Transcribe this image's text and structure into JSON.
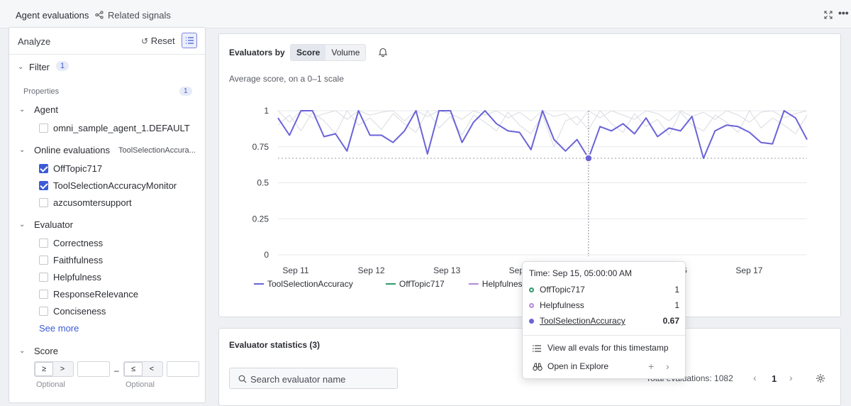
{
  "topbar": {
    "tab_agent_evaluations": "Agent evaluations",
    "tab_related_signals": "Related signals",
    "more_label": "•••"
  },
  "sidebar": {
    "title": "Analyze",
    "reset_label": "Reset",
    "filter_label": "Filter",
    "filter_count": "1",
    "properties_label": "Properties",
    "properties_count": "1",
    "agent": {
      "label": "Agent",
      "options": [
        {
          "label": "omni_sample_agent_1.DEFAULT",
          "checked": false
        }
      ]
    },
    "online_evaluations": {
      "label": "Online evaluations",
      "summary": "ToolSelectionAccura...",
      "options": [
        {
          "label": "OffTopic717",
          "checked": true
        },
        {
          "label": "ToolSelectionAccuracyMonitor",
          "checked": true
        },
        {
          "label": "azcusomtersupport",
          "checked": false
        }
      ]
    },
    "evaluator": {
      "label": "Evaluator",
      "options": [
        {
          "label": "Correctness",
          "checked": false
        },
        {
          "label": "Faithfulness",
          "checked": false
        },
        {
          "label": "Helpfulness",
          "checked": false
        },
        {
          "label": "ResponseRelevance",
          "checked": false
        },
        {
          "label": "Conciseness",
          "checked": false
        }
      ],
      "see_more": "See more"
    },
    "score": {
      "label": "Score",
      "min_ops": [
        "≥",
        ">"
      ],
      "max_ops": [
        "≤",
        "<"
      ],
      "separator": "–",
      "min_hint": "Optional",
      "max_hint": "Optional"
    }
  },
  "chart_panel": {
    "title": "Evaluators by",
    "toggle_score": "Score",
    "toggle_volume": "Volume",
    "subtitle": "Average score, on a 0–1 scale"
  },
  "chart_data": {
    "type": "line",
    "ylim": [
      0,
      1
    ],
    "y_ticks": [
      "0",
      "0.25",
      "0.5",
      "0.75",
      "1"
    ],
    "x_ticks": [
      "Sep 11",
      "Sep 12",
      "Sep 13",
      "Sep 14",
      "Sep 15",
      "Sep 16",
      "Sep 17"
    ],
    "x_range_days": [
      10.85,
      17.85
    ],
    "threshold": 0.67,
    "series": [
      {
        "name": "ToolSelectionAccuracy",
        "color": "#6a63d8",
        "highlight": true,
        "values": [
          0.95,
          0.83,
          1.0,
          1.0,
          0.82,
          0.84,
          0.72,
          1.0,
          0.83,
          0.83,
          0.78,
          0.86,
          1.0,
          0.7,
          1.0,
          1.0,
          0.78,
          0.92,
          1.0,
          0.91,
          0.86,
          0.85,
          0.73,
          1.0,
          0.8,
          0.72,
          0.8,
          0.67,
          0.89,
          0.86,
          0.91,
          0.84,
          0.95,
          0.82,
          0.88,
          0.86,
          0.96,
          0.67,
          0.86,
          0.9,
          0.89,
          0.85,
          0.78,
          0.77,
          1.0,
          0.95,
          0.8
        ]
      },
      {
        "name": "OffTopic717",
        "color": "#2e9a6a",
        "highlight": false,
        "values": [
          1.0,
          0.92,
          1.0,
          0.95,
          0.98,
          1.0,
          0.94,
          1.0,
          0.97,
          0.99,
          1.0,
          0.93,
          1.0,
          0.96,
          1.0,
          0.98,
          0.94,
          1.0,
          0.97,
          1.0,
          0.95,
          0.99,
          0.93,
          1.0,
          0.96,
          0.98,
          0.9,
          1.0,
          0.95,
          1.0,
          0.97,
          0.94,
          1.0,
          0.98,
          0.93,
          1.0,
          0.96,
          0.99,
          0.94,
          1.0,
          0.97,
          0.92,
          0.99,
          1.0,
          0.95,
          0.98,
          1.0
        ]
      },
      {
        "name": "Helpfulness",
        "color": "#b58ad8",
        "highlight": false,
        "values": [
          0.9,
          0.97,
          0.86,
          0.99,
          0.93,
          0.84,
          1.0,
          0.9,
          0.95,
          0.87,
          0.98,
          0.91,
          0.85,
          1.0,
          0.88,
          0.96,
          0.83,
          0.97,
          0.92,
          0.86,
          0.99,
          0.9,
          0.84,
          0.97,
          0.75,
          0.93,
          0.96,
          0.87,
          1.0,
          0.91,
          0.85,
          0.98,
          0.89,
          0.94,
          0.83,
          0.99,
          0.9,
          0.86,
          0.97,
          0.92,
          0.85,
          1.0,
          0.88,
          0.95,
          0.9,
          0.84,
          0.97
        ]
      }
    ]
  },
  "tooltip": {
    "time": "Time: Sep 15, 05:00:00 AM",
    "rows": [
      {
        "name": "OffTopic717",
        "value": "1",
        "color": "#2e9a6a"
      },
      {
        "name": "Helpfulness",
        "value": "1",
        "color": "#b58ad8"
      },
      {
        "name": "ToolSelectionAccuracy",
        "value": "0.67",
        "color": "#6a63d8"
      }
    ],
    "action_view_all": "View all evals for this timestamp",
    "action_open_explore": "Open in Explore"
  },
  "stats_panel": {
    "title": "Evaluator statistics (3)",
    "search_placeholder": "Search evaluator name",
    "total_label": "Total evaluations: 1082",
    "page": "1"
  }
}
